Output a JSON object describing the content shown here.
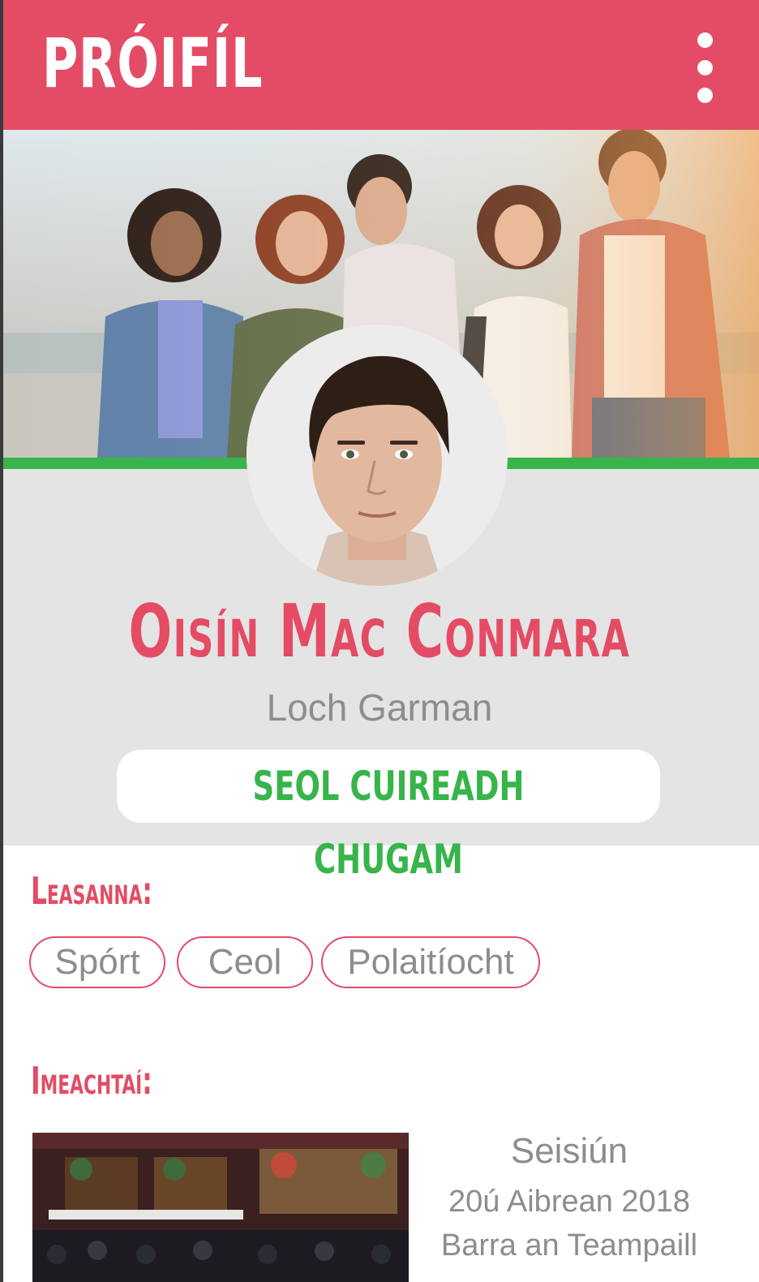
{
  "header": {
    "title": "PRÓIFÍL",
    "menu_icon": "more-vertical-icon",
    "background": "#e34c64"
  },
  "profile": {
    "name": "Oisín Mac Conmara",
    "location": "Loch Garman",
    "invite_label": "SEOL CUIREADH CHUGAM"
  },
  "interests": {
    "title": "Leasanna:",
    "items": [
      "Spórt",
      "Ceol",
      "Polaitíocht"
    ]
  },
  "events": {
    "title": "Imeachtaí:",
    "items": [
      {
        "name": "Seisiún",
        "date": "20ú Aibrean 2018",
        "venue": "Barra an Teampaill"
      }
    ]
  },
  "colors": {
    "accent": "#e34c64",
    "green": "#37b44a",
    "muted_text": "#8d8d8d",
    "card_bg": "#e4e4e4"
  }
}
